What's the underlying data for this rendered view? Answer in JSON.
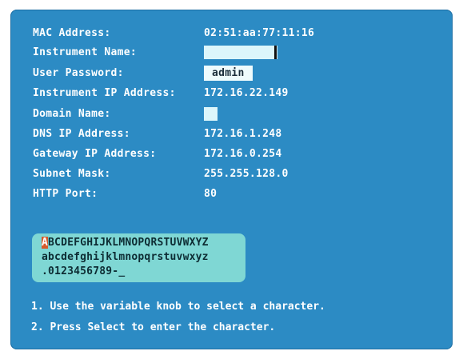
{
  "settings": [
    {
      "key": "mac",
      "label": "MAC Address:",
      "value": "02:51:aa:77:11:16"
    },
    {
      "key": "instrument_name",
      "label": "Instrument Name:",
      "value": ""
    },
    {
      "key": "user_password",
      "label": "User Password:",
      "value": "admin"
    },
    {
      "key": "instrument_ip",
      "label": "Instrument IP Address:",
      "value": "172.16.22.149"
    },
    {
      "key": "domain_name",
      "label": "Domain Name:",
      "value": ""
    },
    {
      "key": "dns_ip",
      "label": "DNS IP Address:",
      "value": "172.16.1.248"
    },
    {
      "key": "gateway_ip",
      "label": "Gateway IP Address:",
      "value": "172.16.0.254"
    },
    {
      "key": "subnet_mask",
      "label": "Subnet Mask:",
      "value": "255.255.128.0"
    },
    {
      "key": "http_port",
      "label": "HTTP Port:",
      "value": "80"
    }
  ],
  "char_selector": {
    "selected_char": "A",
    "line1_rest": "BCDEFGHIJKLMNOPQRSTUVWXYZ",
    "line2": "abcdefghijklmnopqrstuvwxyz",
    "line3": ".0123456789-_"
  },
  "instructions": [
    "1. Use the variable knob to select a character.",
    "2. Press Select to enter the character."
  ],
  "colors": {
    "screen_bg": "#2c8bc4",
    "panel_bg": "#7fd7d4",
    "highlight": "#d65a2a",
    "field_bg": "#dcf6fb"
  }
}
